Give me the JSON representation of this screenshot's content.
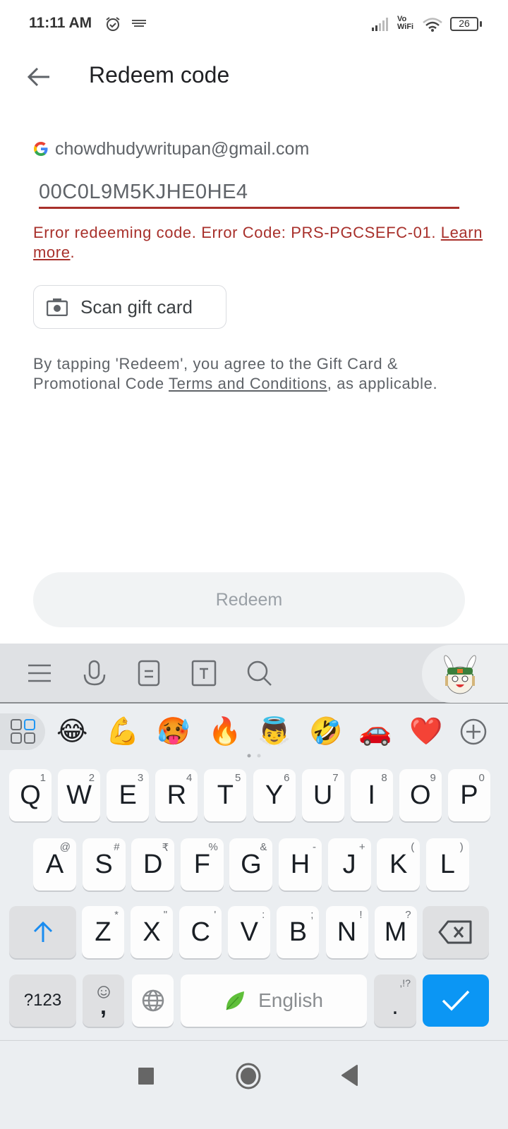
{
  "status_bar": {
    "time": "11:11 AM",
    "network_label_1": "Vo",
    "network_label_2": "WiFi",
    "battery": "26",
    "icons": [
      "alarm-icon",
      "keyboard-icon",
      "signal-icon",
      "vowifi-icon",
      "wifi-icon",
      "battery-icon"
    ]
  },
  "header": {
    "back_icon": "arrow-left-icon",
    "title": "Redeem code"
  },
  "account": {
    "icon": "google-logo",
    "email": "chowdhudywritupan@gmail.com"
  },
  "code_input": {
    "value": "00C0L9M5KJHE0HE4"
  },
  "error": {
    "message": "Error redeeming code. Error Code: PRS-PGCSEFC-01.",
    "link": "Learn more",
    "suffix": "."
  },
  "scan_button": {
    "icon": "camera-icon",
    "label": "Scan gift card"
  },
  "terms": {
    "prefix": "By tapping 'Redeem', you agree to the Gift Card & Promotional Code ",
    "link": "Terms and Conditions",
    "suffix": ", as applicable."
  },
  "redeem_button": {
    "label": "Redeem"
  },
  "keyboard": {
    "toolbar_icons": [
      "menu-icon",
      "microphone-icon",
      "clipboard-icon",
      "text-edit-icon",
      "search-icon",
      "mascot-icon"
    ],
    "emojis": [
      "😂",
      "💪",
      "🥵",
      "🔥",
      "👼",
      "🤣",
      "🚗",
      "❤️"
    ],
    "row1": [
      {
        "key": "Q",
        "alt": "1"
      },
      {
        "key": "W",
        "alt": "2"
      },
      {
        "key": "E",
        "alt": "3"
      },
      {
        "key": "R",
        "alt": "4"
      },
      {
        "key": "T",
        "alt": "5"
      },
      {
        "key": "Y",
        "alt": "6"
      },
      {
        "key": "U",
        "alt": "7"
      },
      {
        "key": "I",
        "alt": "8"
      },
      {
        "key": "O",
        "alt": "9"
      },
      {
        "key": "P",
        "alt": "0"
      }
    ],
    "row2": [
      {
        "key": "A",
        "alt": "@"
      },
      {
        "key": "S",
        "alt": "#"
      },
      {
        "key": "D",
        "alt": "₹"
      },
      {
        "key": "F",
        "alt": "%"
      },
      {
        "key": "G",
        "alt": "&"
      },
      {
        "key": "H",
        "alt": "-"
      },
      {
        "key": "J",
        "alt": "+"
      },
      {
        "key": "K",
        "alt": "("
      },
      {
        "key": "L",
        "alt": ")"
      }
    ],
    "row3": [
      {
        "key": "Z",
        "alt": "*"
      },
      {
        "key": "X",
        "alt": "\""
      },
      {
        "key": "C",
        "alt": "'"
      },
      {
        "key": "V",
        "alt": ":"
      },
      {
        "key": "B",
        "alt": ";"
      },
      {
        "key": "N",
        "alt": "!"
      },
      {
        "key": "M",
        "alt": "?"
      }
    ],
    "symbols_key": "?123",
    "comma_key": ",",
    "space_label": "English",
    "period_key": ".",
    "period_alt": ",!?",
    "accent_color": "#0b96f4"
  },
  "navbar": {
    "icons": [
      "recents-square-icon",
      "home-circle-icon",
      "back-triangle-icon"
    ]
  },
  "colors": {
    "error": "#a8302b",
    "keyboard_accent": "#0b96f4"
  }
}
